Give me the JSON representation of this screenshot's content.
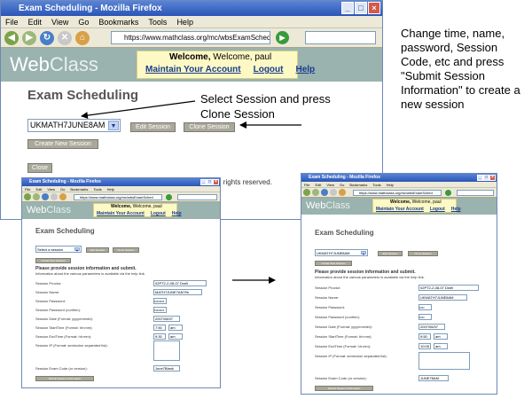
{
  "browser": {
    "title": "Exam Scheduling - Mozilla Firefox",
    "menu": [
      "File",
      "Edit",
      "View",
      "Go",
      "Bookmarks",
      "Tools",
      "Help"
    ],
    "url": "https://www.mathclass.org/mc/wbsExamSched...",
    "url_small": "https://www.mathclass.org/mc/wbsExamSched"
  },
  "app": {
    "logo_a": "Web",
    "logo_b": "Class",
    "welcome": "Welcome, paul",
    "links": [
      "Maintain Your Account",
      "Logout",
      "Help"
    ]
  },
  "main": {
    "heading": "Exam Scheduling",
    "session_selected": "UKMATH7JUNE8AM",
    "edit_label": "Edit Session",
    "clone_label": "Clone Session",
    "create_label": "Create New Session",
    "close_label": "Close",
    "footer": "ll rights reserved."
  },
  "left": {
    "select_value": "Select a session",
    "btn1": "Edit Session",
    "btn2": "Clone Session",
    "create_label": "Create New Session",
    "instr_bold": "Please provide session information and submit.",
    "instr": "Information about the various parameters is available via the help link.",
    "labels": [
      "Session Proctor:",
      "Session Name:",
      "Session Password:",
      "Session Password (confirm):",
      "Session Date (Format: yyyy/mm/dd):",
      "Session StartTime (Format: hh:mm):",
      "Session EndTime (Format: hh:mm):",
      "Session IP (Format: semicolon separated list):",
      "Session Exam Code (or version):"
    ],
    "values": [
      "02PT2-2-08-07 Draft",
      "MATH7JUNE7AM Re",
      "••••••••",
      "••••••••",
      "2007/08/07",
      "7:50",
      "9:30",
      "",
      "June7Blank"
    ],
    "ampm": [
      "am",
      "am"
    ],
    "submit": "Submit Session Information"
  },
  "right": {
    "select_value": "UKMATH7JUNE8AM",
    "btn1": "Edit Session",
    "btn2": "Clone Session",
    "create_label": "Create New Session",
    "instr_bold": "Please provide session information and submit.",
    "instr": "Information about the various parameters is available via the help link.",
    "labels": [
      "Session Proctor:",
      "Session Name:",
      "Session Password:",
      "Session Password (confirm):",
      "Session Date (Format: yyyy/mm/dd):",
      "Session StartTime (Format: hh:mm):",
      "Session EndTime (Format: hh:mm):",
      "Session IP (Format: semicolon separated list):",
      "Session Exam Code (or version):"
    ],
    "values": [
      "02PT2-2-08-07 Draft",
      "UKMATH7JUNE8AM",
      "••••",
      "••••",
      "2007/06/07",
      "9:50",
      "10:05",
      "",
      "JUNE78AM"
    ],
    "ampm": [
      "am",
      "am"
    ],
    "submit": "Submit Session Information"
  },
  "notes": {
    "select_clone": "Select Session and press Clone Session",
    "change": "Change time, name, password, Session Code, etc and press \"Submit Session Information\" to create a new session"
  }
}
